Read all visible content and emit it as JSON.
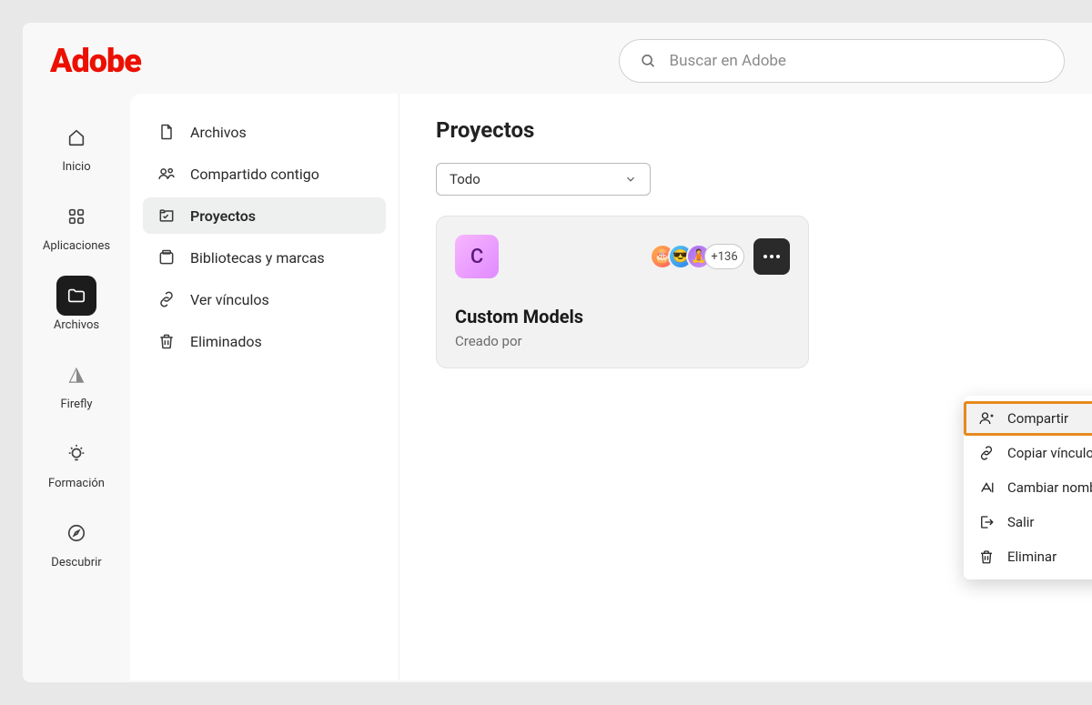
{
  "brand": "Adobe",
  "search": {
    "placeholder": "Buscar en Adobe"
  },
  "rail": {
    "home": {
      "label": "Inicio"
    },
    "apps": {
      "label": "Aplicaciones"
    },
    "files": {
      "label": "Archivos"
    },
    "firefly": {
      "label": "Firefly"
    },
    "learn": {
      "label": "Formación"
    },
    "discover": {
      "label": "Descubrir"
    }
  },
  "panel": {
    "archives": "Archivos",
    "shared": "Compartido contigo",
    "projects": "Proyectos",
    "libs": "Bibliotecas y marcas",
    "links": "Ver vínculos",
    "deleted": "Eliminados"
  },
  "main": {
    "title": "Proyectos",
    "filter": "Todo",
    "card": {
      "thumb_letter": "C",
      "overflow": "+136",
      "title": "Custom Models",
      "subtitle": "Creado por"
    }
  },
  "menu": {
    "share": "Compartir",
    "copy": "Copiar vínculo",
    "rename": "Cambiar nombre",
    "leave": "Salir",
    "delete": "Eliminar"
  }
}
